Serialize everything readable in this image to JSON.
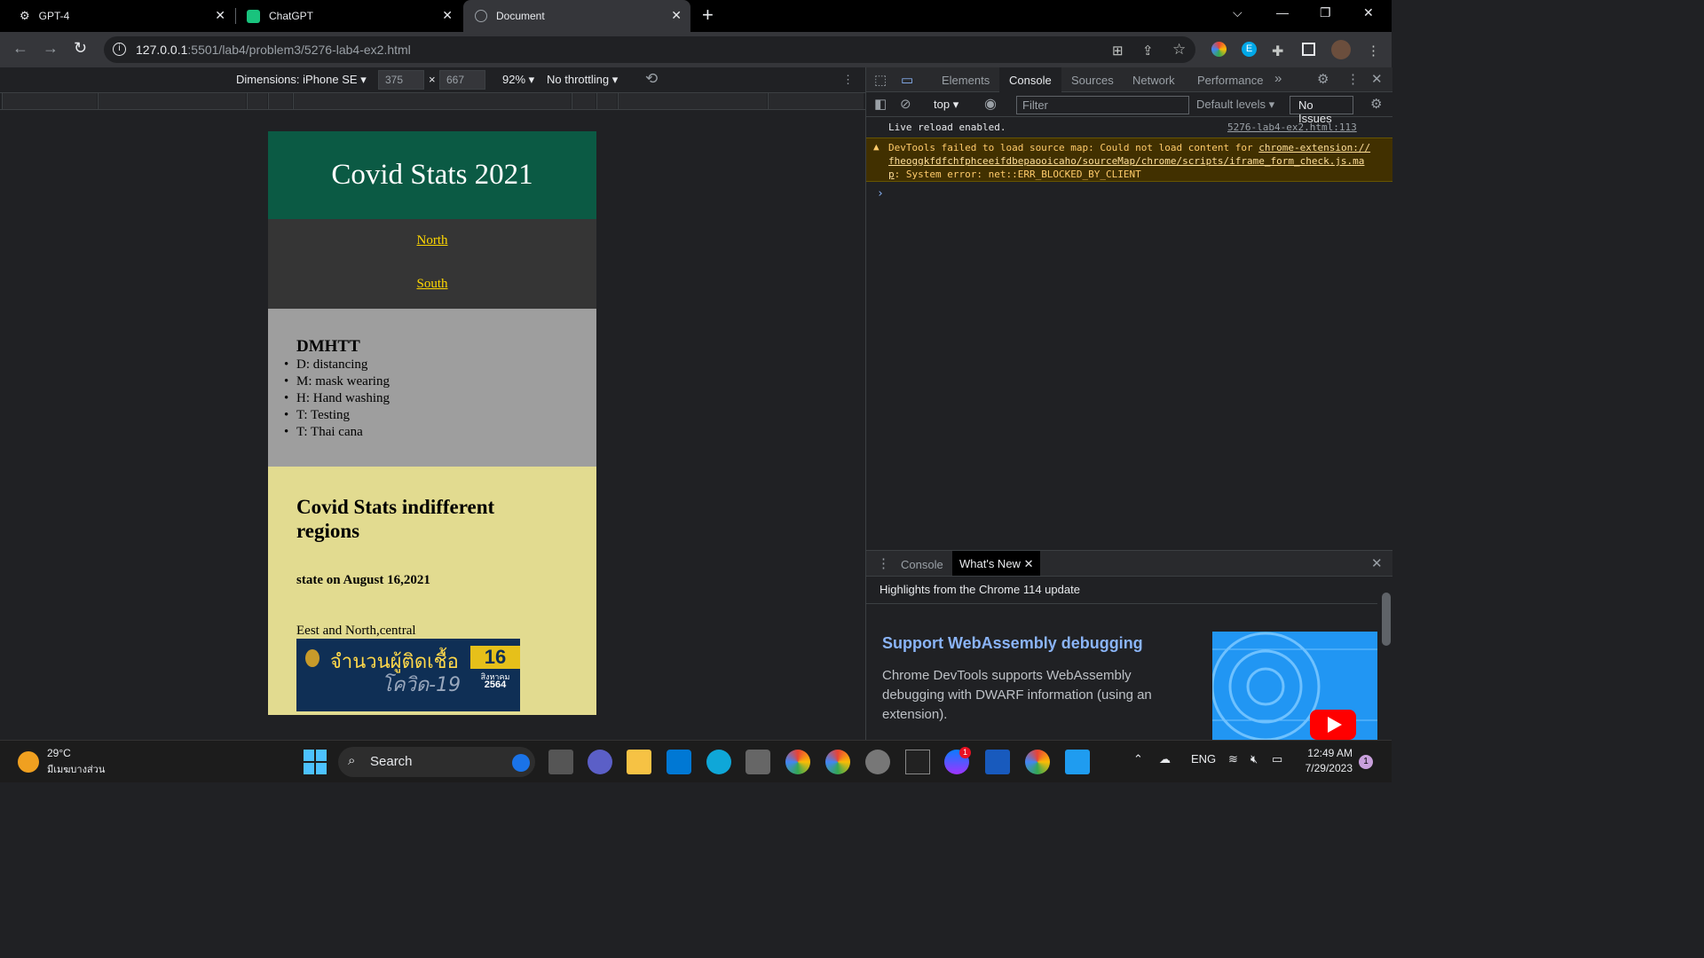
{
  "browser": {
    "tabs": [
      {
        "title": "GPT-4",
        "close": "✕"
      },
      {
        "title": "ChatGPT",
        "close": "✕"
      },
      {
        "title": "Document",
        "close": "✕"
      }
    ],
    "new_tab": "+",
    "url_host": "127.0.0.1",
    "url_rest": ":5501/lab4/problem3/5276-lab4-ex2.html",
    "window_controls": {
      "dropdown": "⌵",
      "minimize": "—",
      "restore": "❐",
      "close": "✕"
    }
  },
  "emulation": {
    "dimensions_label": "Dimensions: iPhone SE",
    "width": "375",
    "times": "×",
    "height": "667",
    "zoom": "92%",
    "throttling": "No throttling"
  },
  "page": {
    "title": "Covid Stats 2021",
    "nav": [
      "North",
      "South"
    ],
    "dmhtt_heading": "DMHTT",
    "dmhtt_items": [
      "D: distancing",
      "M: mask wearing",
      "H: Hand washing",
      "T: Testing",
      "T: Thai cana"
    ],
    "stats_heading": "Covid Stats indifferent regions",
    "state_heading": "state on August 16,2021",
    "region_text": "Eest and North,central",
    "banner": {
      "line1": "จำนวนผู้ติดเชื้อ",
      "line2": "โควิด-19",
      "day": "16",
      "month": "สิงหาคม",
      "year": "2564"
    }
  },
  "devtools": {
    "tabs": [
      "Elements",
      "Console",
      "Sources",
      "Network",
      "Performance"
    ],
    "more": "»",
    "context": "top",
    "filter_placeholder": "Filter",
    "levels": "Default levels",
    "issues": "No Issues",
    "console_lines": {
      "live_reload": "Live reload enabled.",
      "live_reload_source": "5276-lab4-ex2.html:113",
      "warn_prefix": "DevTools failed to load source map: Could not load content for ",
      "warn_link": "chrome-extension://fheoggkfdfchfphceeifdbepaooicaho/sourceMap/chrome/scripts/iframe_form_check.js.map",
      "warn_suffix": ": System error: net::ERR_BLOCKED_BY_CLIENT",
      "prompt": "›"
    },
    "drawer_tabs": [
      "Console",
      "What's New"
    ],
    "whats_new": {
      "highlight": "Highlights from the Chrome 114 update",
      "title": "Support WebAssembly debugging",
      "description": "Chrome DevTools supports WebAssembly debugging with DWARF information (using an extension)."
    }
  },
  "taskbar": {
    "weather_temp": "29°C",
    "weather_location": "มีเมฆบางส่วน",
    "search": "Search",
    "lang": "ENG",
    "time": "12:49 AM",
    "date": "7/29/2023",
    "notifications": "1",
    "messenger_badge": "1"
  },
  "colors": {
    "header": "#0b5a44",
    "nav": "#353535",
    "link": "#ffd700",
    "gray_section": "#9e9e9e",
    "yellow_section": "#e2db90"
  }
}
